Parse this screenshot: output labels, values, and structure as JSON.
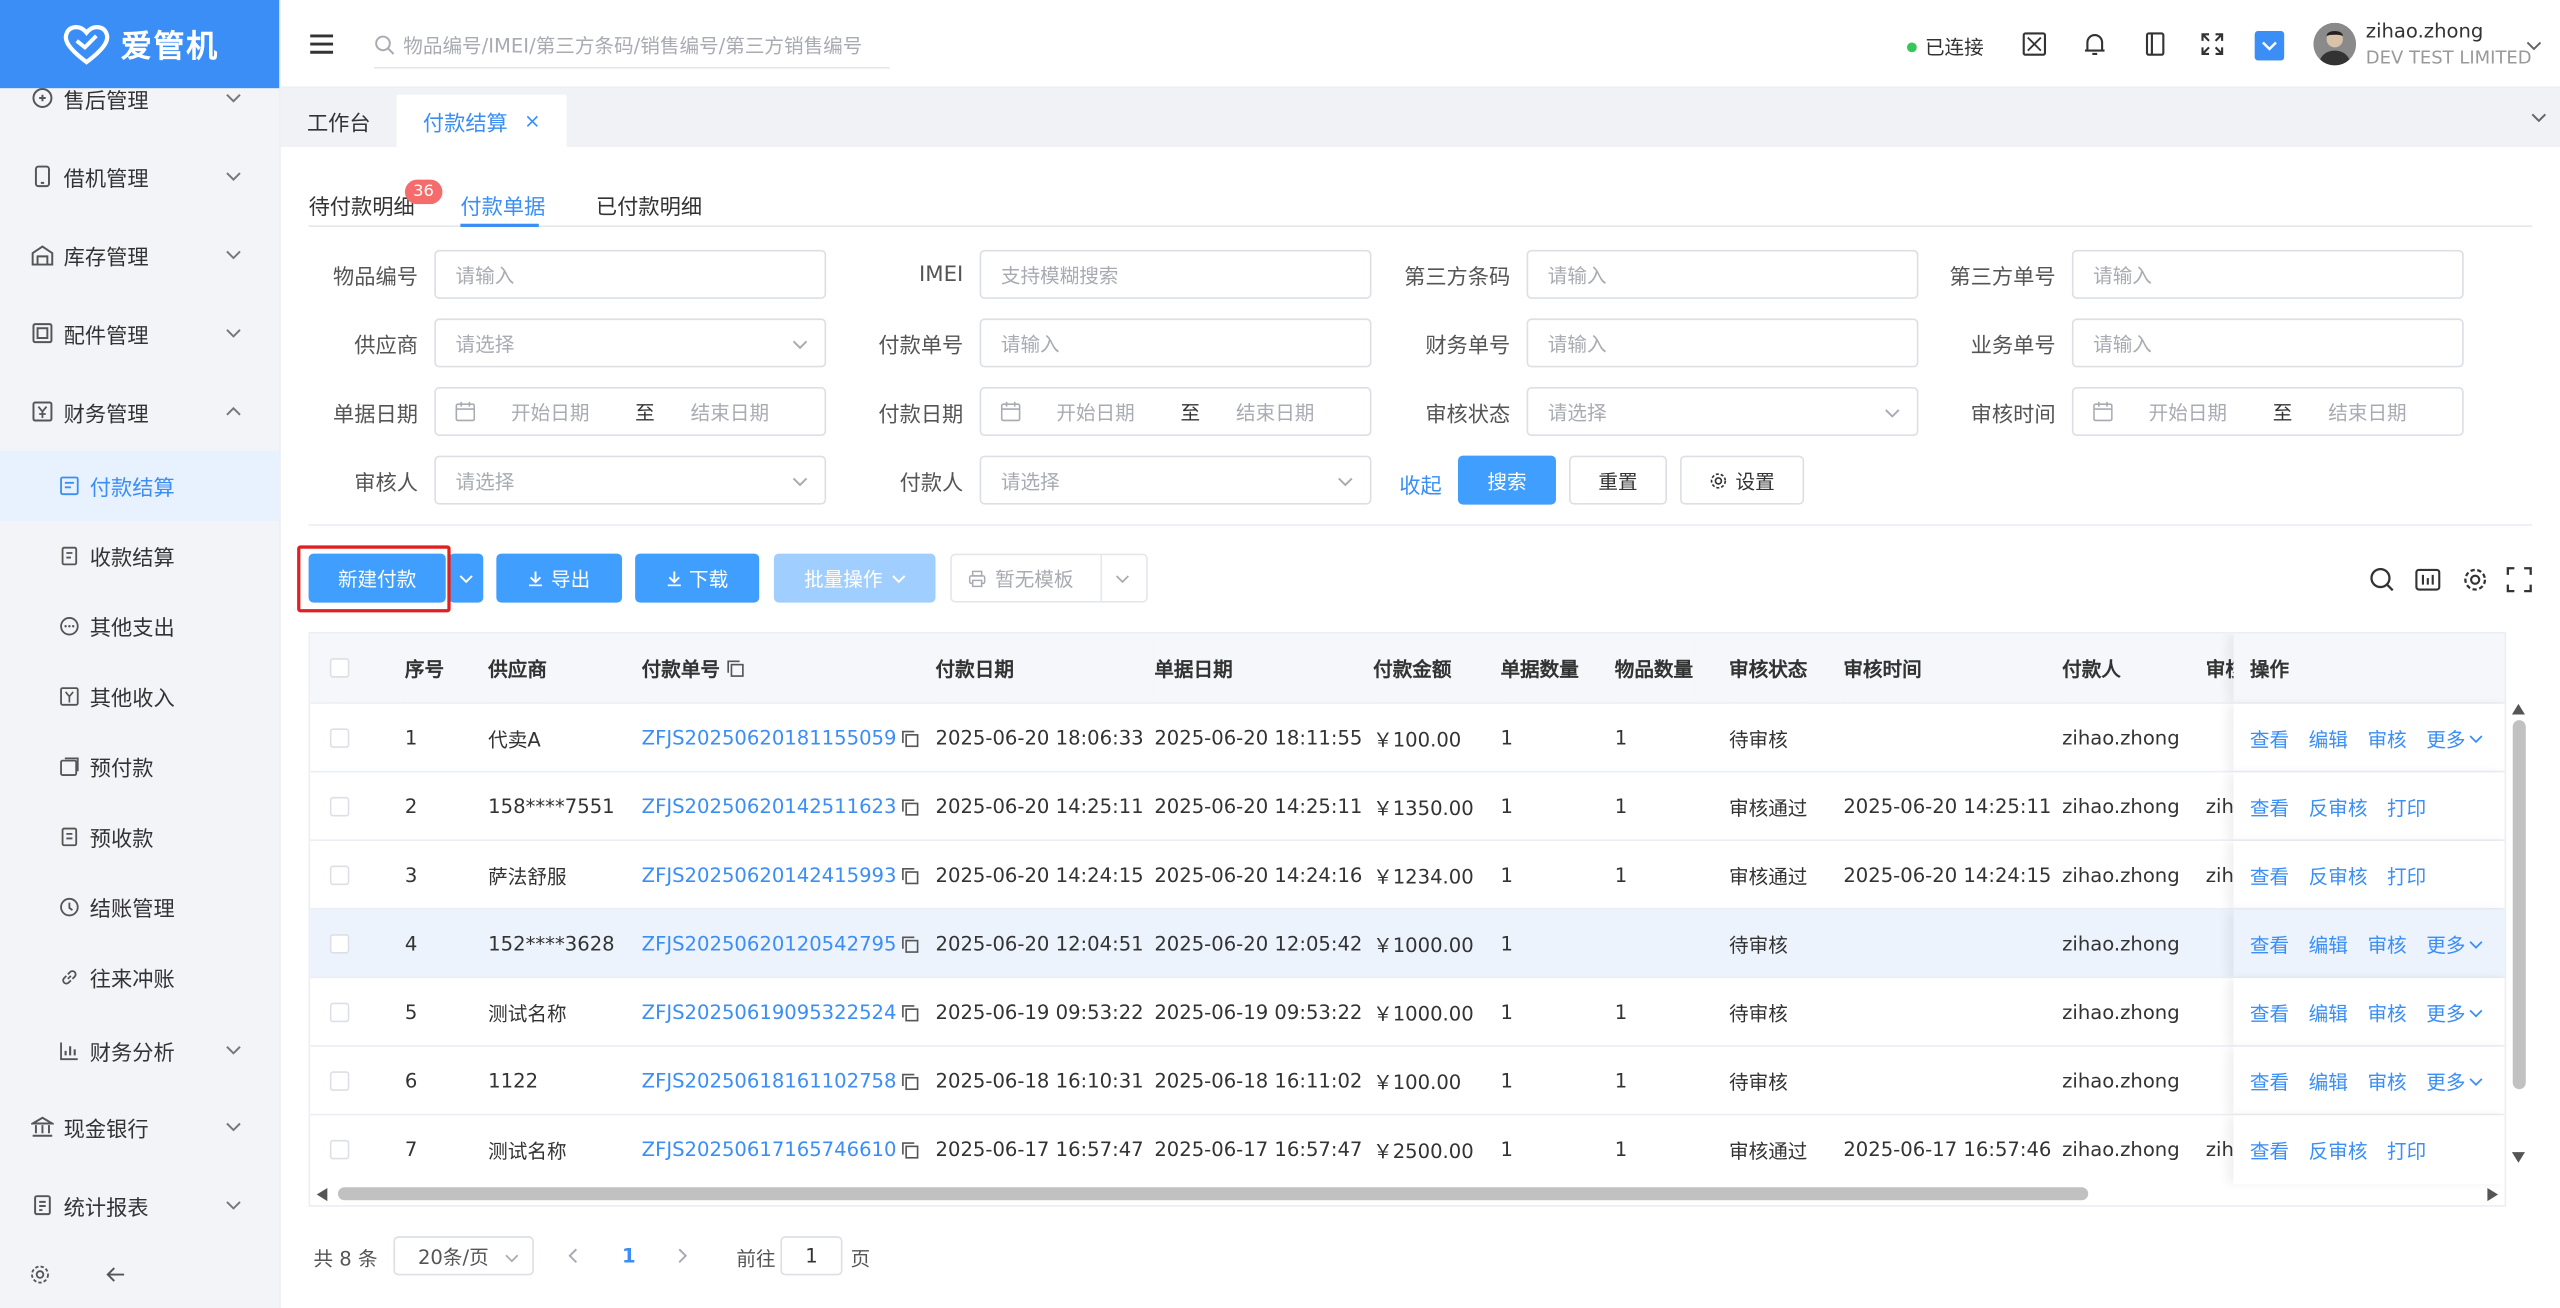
{
  "app": {
    "name": "爱管机"
  },
  "header": {
    "search_placeholder": "物品编号/IMEI/第三方条码/销售编号/第三方销售编号",
    "connection_status": "已连接",
    "user_name": "zihao.zhong",
    "company": "DEV TEST LIMITED"
  },
  "sidebar": {
    "items": [
      {
        "label": "售后管理",
        "icon": "aftersale-icon"
      },
      {
        "label": "借机管理",
        "icon": "phone-icon"
      },
      {
        "label": "库存管理",
        "icon": "warehouse-icon"
      },
      {
        "label": "配件管理",
        "icon": "parts-icon"
      },
      {
        "label": "财务管理",
        "icon": "finance-icon",
        "expanded": true
      }
    ],
    "finance_children": [
      {
        "label": "付款结算",
        "icon": "payment-icon",
        "active": true
      },
      {
        "label": "收款结算",
        "icon": "receipt-icon"
      },
      {
        "label": "其他支出",
        "icon": "expense-icon"
      },
      {
        "label": "其他收入",
        "icon": "income-icon"
      },
      {
        "label": "预付款",
        "icon": "prepay-icon"
      },
      {
        "label": "预收款",
        "icon": "prereceive-icon"
      },
      {
        "label": "结账管理",
        "icon": "clock-icon"
      },
      {
        "label": "往来冲账",
        "icon": "link-icon"
      },
      {
        "label": "财务分析",
        "icon": "chart-icon"
      }
    ],
    "bottom_items": [
      {
        "label": "现金银行",
        "icon": "bank-icon"
      },
      {
        "label": "统计报表",
        "icon": "report-icon"
      }
    ]
  },
  "page_tabs": [
    {
      "label": "工作台"
    },
    {
      "label": "付款结算",
      "active": true,
      "close": "×"
    }
  ],
  "sub_tabs": {
    "pending": "待付款明细",
    "pending_badge": "36",
    "bills": "付款单据",
    "paid": "已付款明细"
  },
  "filters": {
    "item_no": {
      "label": "物品编号",
      "placeholder": "请输入"
    },
    "imei": {
      "label": "IMEI",
      "placeholder": "支持模糊搜索"
    },
    "third_code": {
      "label": "第三方条码",
      "placeholder": "请输入"
    },
    "third_no": {
      "label": "第三方单号",
      "placeholder": "请输入"
    },
    "supplier": {
      "label": "供应商",
      "placeholder": "请选择"
    },
    "pay_no": {
      "label": "付款单号",
      "placeholder": "请输入"
    },
    "fin_no": {
      "label": "财务单号",
      "placeholder": "请输入"
    },
    "biz_no": {
      "label": "业务单号",
      "placeholder": "请输入"
    },
    "bill_date": {
      "label": "单据日期"
    },
    "pay_date": {
      "label": "付款日期"
    },
    "audit_status": {
      "label": "审核状态",
      "placeholder": "请选择"
    },
    "audit_time": {
      "label": "审核时间"
    },
    "auditor": {
      "label": "审核人",
      "placeholder": "请选择"
    },
    "payer": {
      "label": "付款人",
      "placeholder": "请选择"
    },
    "date_start": "开始日期",
    "date_to": "至",
    "date_end": "结束日期",
    "collapse": "收起",
    "search": "搜索",
    "reset": "重置",
    "settings": "设置"
  },
  "actions": {
    "new_payment": "新建付款",
    "export": "导出",
    "download": "下载",
    "batch": "批量操作",
    "no_template": "暂无模板"
  },
  "table": {
    "columns": [
      "序号",
      "供应商",
      "付款单号",
      "付款日期",
      "单据日期",
      "付款金额",
      "单据数量",
      "物品数量",
      "审核状态",
      "审核时间",
      "付款人",
      "审核",
      "操作"
    ],
    "rows": [
      {
        "no": "1",
        "supplier": "代卖A",
        "pay_no": "ZFJS20250620181155059",
        "pay_date": "2025-06-20 18:06:33",
        "bill_date": "2025-06-20 18:11:55",
        "amount": "￥100.00",
        "bill_qty": "1",
        "item_qty": "1",
        "status": "待审核",
        "audit_time": "",
        "payer": "zihao.zhong",
        "auditor": "",
        "ops": [
          "查看",
          "编辑",
          "审核",
          "更多"
        ]
      },
      {
        "no": "2",
        "supplier": "158****7551",
        "pay_no": "ZFJS20250620142511623",
        "pay_date": "2025-06-20 14:25:11",
        "bill_date": "2025-06-20 14:25:11",
        "amount": "￥1350.00",
        "bill_qty": "1",
        "item_qty": "1",
        "status": "审核通过",
        "audit_time": "2025-06-20 14:25:11",
        "payer": "zihao.zhong",
        "auditor": "zih",
        "ops": [
          "查看",
          "反审核",
          "打印"
        ]
      },
      {
        "no": "3",
        "supplier": "萨法舒服",
        "pay_no": "ZFJS20250620142415993",
        "pay_date": "2025-06-20 14:24:15",
        "bill_date": "2025-06-20 14:24:16",
        "amount": "￥1234.00",
        "bill_qty": "1",
        "item_qty": "1",
        "status": "审核通过",
        "audit_time": "2025-06-20 14:24:15",
        "payer": "zihao.zhong",
        "auditor": "zih",
        "ops": [
          "查看",
          "反审核",
          "打印"
        ]
      },
      {
        "no": "4",
        "supplier": "152****3628",
        "pay_no": "ZFJS20250620120542795",
        "pay_date": "2025-06-20 12:04:51",
        "bill_date": "2025-06-20 12:05:42",
        "amount": "￥1000.00",
        "bill_qty": "1",
        "item_qty": "",
        "status": "待审核",
        "audit_time": "",
        "payer": "zihao.zhong",
        "auditor": "",
        "ops": [
          "查看",
          "编辑",
          "审核",
          "更多"
        ]
      },
      {
        "no": "5",
        "supplier": "测试名称",
        "pay_no": "ZFJS20250619095322524",
        "pay_date": "2025-06-19 09:53:22",
        "bill_date": "2025-06-19 09:53:22",
        "amount": "￥1000.00",
        "bill_qty": "1",
        "item_qty": "1",
        "status": "待审核",
        "audit_time": "",
        "payer": "zihao.zhong",
        "auditor": "",
        "ops": [
          "查看",
          "编辑",
          "审核",
          "更多"
        ]
      },
      {
        "no": "6",
        "supplier": "1122",
        "pay_no": "ZFJS20250618161102758",
        "pay_date": "2025-06-18 16:10:31",
        "bill_date": "2025-06-18 16:11:02",
        "amount": "￥100.00",
        "bill_qty": "1",
        "item_qty": "1",
        "status": "待审核",
        "audit_time": "",
        "payer": "zihao.zhong",
        "auditor": "",
        "ops": [
          "查看",
          "编辑",
          "审核",
          "更多"
        ]
      },
      {
        "no": "7",
        "supplier": "测试名称",
        "pay_no": "ZFJS20250617165746610",
        "pay_date": "2025-06-17 16:57:47",
        "bill_date": "2025-06-17 16:57:47",
        "amount": "￥2500.00",
        "bill_qty": "1",
        "item_qty": "1",
        "status": "审核通过",
        "audit_time": "2025-06-17 16:57:46",
        "payer": "zihao.zhong",
        "auditor": "zih",
        "ops": [
          "查看",
          "反审核",
          "打印"
        ]
      }
    ]
  },
  "pagination": {
    "total": "共 8 条",
    "page_size": "20条/页",
    "current_page": "1",
    "goto_label": "前往",
    "goto_value": "1",
    "page_suffix": "页"
  },
  "colors": {
    "primary": "#409eff",
    "brand": "#3a8ef6",
    "badge": "#f56c6c",
    "highlight_box": "#e02020",
    "connected": "#34c759"
  }
}
